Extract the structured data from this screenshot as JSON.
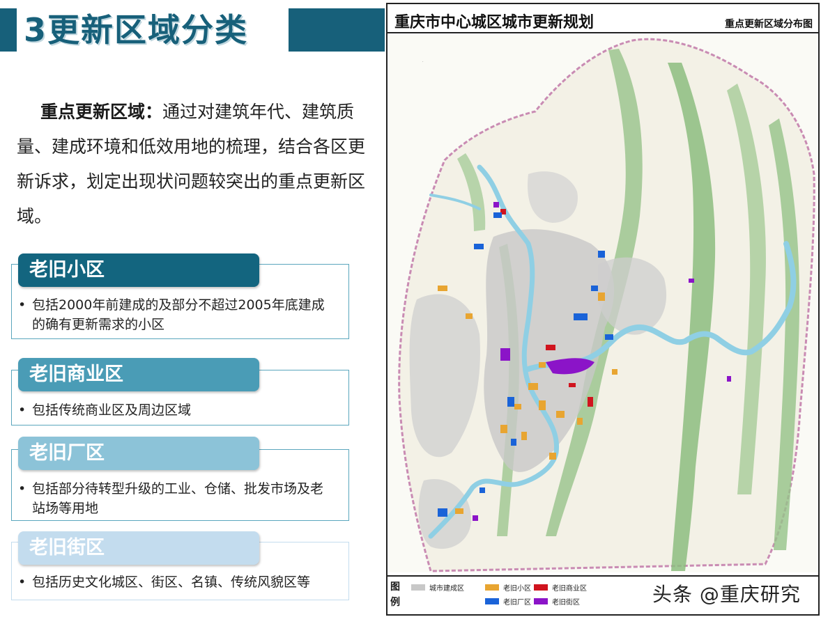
{
  "slide": {
    "title": "3更新区域分类"
  },
  "intro": {
    "lead": "重点更新区域：",
    "text": "通过对建筑年代、建筑质量、建成环境和低效用地的梳理，结合各区更新诉求，划定出现状问题较突出的重点更新区域。"
  },
  "categories": [
    {
      "name": "老旧小区",
      "color": "#13657f",
      "desc": "包括2000年前建成的及部分不超过2005年底建成的确有更新需求的小区"
    },
    {
      "name": "老旧商业区",
      "color": "#4a9cb6",
      "desc": "包括传统商业区及周边区域"
    },
    {
      "name": "老旧厂区",
      "color": "#8cc3d8",
      "desc": "包括部分待转型升级的工业、仓储、批发市场及老站场等用地"
    },
    {
      "name": "老旧街区",
      "color": "#c3dcee",
      "desc": "包括历史文化城区、街区、名镇、传统风貌区等"
    }
  ],
  "map": {
    "title": "重庆市中心城区城市更新规划",
    "subtitle": "重点更新区域分布图",
    "legend_title": "图例",
    "legend": [
      {
        "label": "城市建成区",
        "color": "#c8c8c8"
      },
      {
        "label": "老旧小区",
        "color": "#e8a531"
      },
      {
        "label": "老旧商业区",
        "color": "#d0141e"
      },
      {
        "label": "老旧厂区",
        "color": "#1a63d8"
      },
      {
        "label": "老旧街区",
        "color": "#8b14c8"
      }
    ],
    "colors": {
      "river": "#8fcfe4",
      "ridge": "#7cb374",
      "builtup": "#c8c8c8",
      "boundary": "#c98bb3"
    }
  },
  "watermark": "头条 @重庆研究"
}
